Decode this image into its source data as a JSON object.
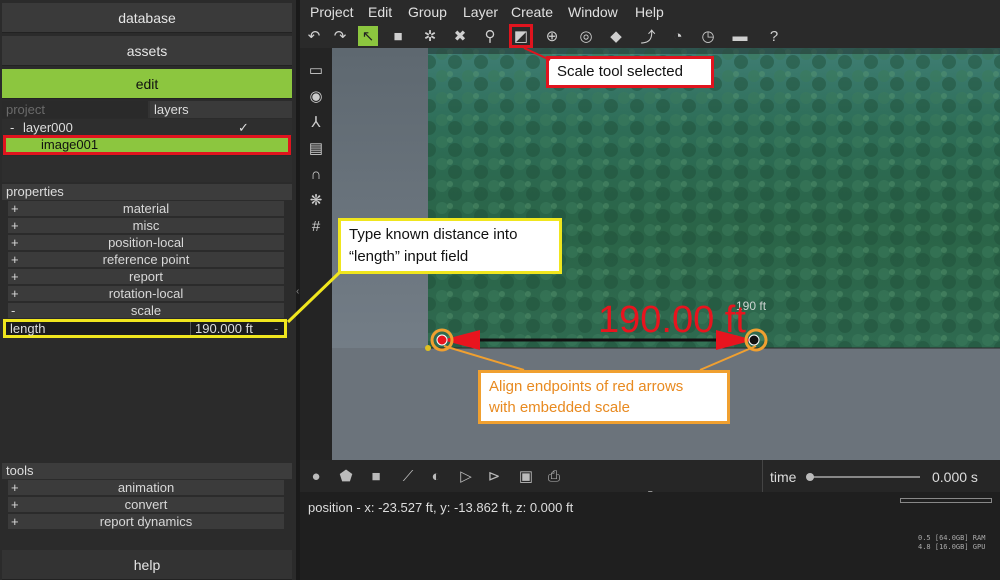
{
  "left_panel": {
    "database": "database",
    "assets": "assets",
    "edit": "edit",
    "tabs": [
      "project",
      "layers"
    ],
    "layer": {
      "toggle": "-",
      "name": "layer000",
      "check": "✓"
    },
    "image": "image001",
    "properties_header": "properties",
    "properties": [
      {
        "sign": "+",
        "label": "material"
      },
      {
        "sign": "+",
        "label": "misc"
      },
      {
        "sign": "+",
        "label": "position-local"
      },
      {
        "sign": "+",
        "label": "reference point"
      },
      {
        "sign": "+",
        "label": "report"
      },
      {
        "sign": "+",
        "label": "rotation-local"
      },
      {
        "sign": "-",
        "label": "scale"
      }
    ],
    "length_label": "length",
    "length_value": "190.000 ft",
    "length_dash": "-",
    "tools_header": "tools",
    "tools": [
      {
        "sign": "+",
        "label": "animation"
      },
      {
        "sign": "+",
        "label": "convert"
      },
      {
        "sign": "+",
        "label": "report dynamics"
      }
    ],
    "help": "help"
  },
  "menu": [
    "Project",
    "Edit",
    "Group",
    "Layer",
    "Create",
    "Window",
    "Help"
  ],
  "icons": {
    "toolbar": [
      "undo-icon",
      "redo-icon",
      "select-icon",
      "box-icon",
      "satellite-icon",
      "crash-icon",
      "zoom-icon",
      "scale-icon",
      "move-icon",
      "dial-icon",
      "ramp-icon",
      "path-icon",
      "gauge-icon",
      "speedometer-icon",
      "tape-icon",
      "help-icon"
    ],
    "sidebar": [
      "camera-icon",
      "target-icon",
      "axes-icon",
      "film-icon",
      "magnet-icon",
      "molecule-icon",
      "grid-icon"
    ]
  },
  "viewport": {
    "measurement": "190.00 ft",
    "embedded_scale_label": "190 ft"
  },
  "timeline": {
    "time_label": "time",
    "time_value": "0.000 s"
  },
  "status": {
    "position": "position - x: -23.527 ft, y: -13.862 ft, z: 0.000 ft",
    "ram": "0.5 [64.0GB] RAM",
    "gpu": "4.8 [16.0GB] GPU"
  },
  "annotations": {
    "scale_tool": "Scale tool selected",
    "length_hint_1": "Type known distance into",
    "length_hint_2": "“length” input field",
    "align_1": "Align endpoints of red arrows",
    "align_2": "with embedded scale"
  },
  "colors": {
    "accent_green": "#8cc63f",
    "highlight_red": "#e0141e",
    "callout_yellow": "#f0e61e",
    "callout_orange": "#f0a030",
    "measure_red": "#e8141e"
  }
}
